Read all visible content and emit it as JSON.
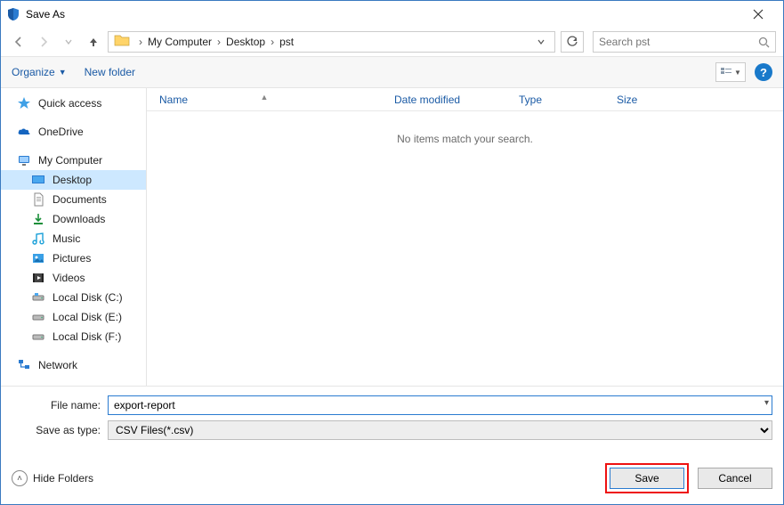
{
  "window": {
    "title": "Save As"
  },
  "breadcrumbs": {
    "b0": "My Computer",
    "b1": "Desktop",
    "b2": "pst"
  },
  "search": {
    "placeholder": "Search pst"
  },
  "toolbar": {
    "organize": "Organize",
    "newfolder": "New folder"
  },
  "sidebar": {
    "quick": "Quick access",
    "onedrive": "OneDrive",
    "mycomputer": "My Computer",
    "desktop": "Desktop",
    "documents": "Documents",
    "downloads": "Downloads",
    "music": "Music",
    "pictures": "Pictures",
    "videos": "Videos",
    "diskc": "Local Disk (C:)",
    "diske": "Local Disk (E:)",
    "diskf": "Local Disk (F:)",
    "network": "Network"
  },
  "columns": {
    "name": "Name",
    "date": "Date modified",
    "type": "Type",
    "size": "Size"
  },
  "list": {
    "empty": "No items match your search."
  },
  "form": {
    "filename_label": "File name:",
    "filename_value": "export-report",
    "type_label": "Save as type:",
    "type_value": "CSV Files(*.csv)"
  },
  "footer": {
    "hidefolders": "Hide Folders",
    "save": "Save",
    "cancel": "Cancel"
  }
}
